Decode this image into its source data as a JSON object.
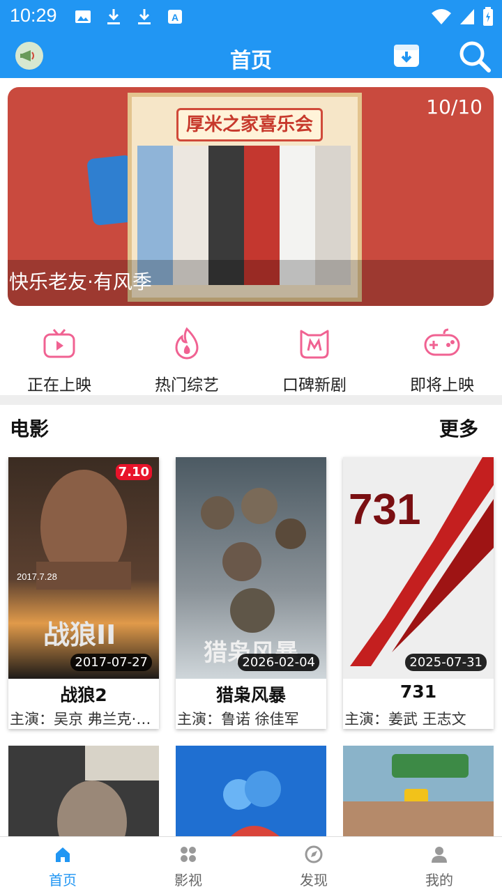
{
  "status_bar": {
    "time": "10:29"
  },
  "app_bar": {
    "title": "首页"
  },
  "banner": {
    "counter": "10/10",
    "caption": "快乐老友·有风季",
    "headline": "厚米之家喜乐会"
  },
  "quick_nav": [
    {
      "label": "正在上映",
      "icon": "tv-play-icon",
      "color": "#f06292"
    },
    {
      "label": "热门综艺",
      "icon": "flame-icon",
      "color": "#f06292"
    },
    {
      "label": "口碑新剧",
      "icon": "cat-m-icon",
      "color": "#f06292"
    },
    {
      "label": "即将上映",
      "icon": "gamepad-icon",
      "color": "#f06292"
    }
  ],
  "movies_section": {
    "title": "电影",
    "more": "更多",
    "items": [
      {
        "title": "战狼2",
        "cast": "主演：吴京 弗兰克·格里罗",
        "date": "2017-07-27",
        "rating": "7.10",
        "poster_text": "2017.7.28"
      },
      {
        "title": "猎枭风暴",
        "cast": "主演：鲁诺 徐佳军",
        "date": "2026-02-04",
        "poster_text": "猎枭风暴"
      },
      {
        "title": "731",
        "cast": "主演：姜武 王志文",
        "date": "2025-07-31",
        "poster_text": "731"
      }
    ]
  },
  "bottom_nav": [
    {
      "label": "首页",
      "icon": "home-icon",
      "active": true
    },
    {
      "label": "影视",
      "icon": "grid-icon"
    },
    {
      "label": "发现",
      "icon": "compass-icon"
    },
    {
      "label": "我的",
      "icon": "profile-icon"
    }
  ],
  "colors": {
    "primary": "#2196f3",
    "accent": "#f06292"
  }
}
